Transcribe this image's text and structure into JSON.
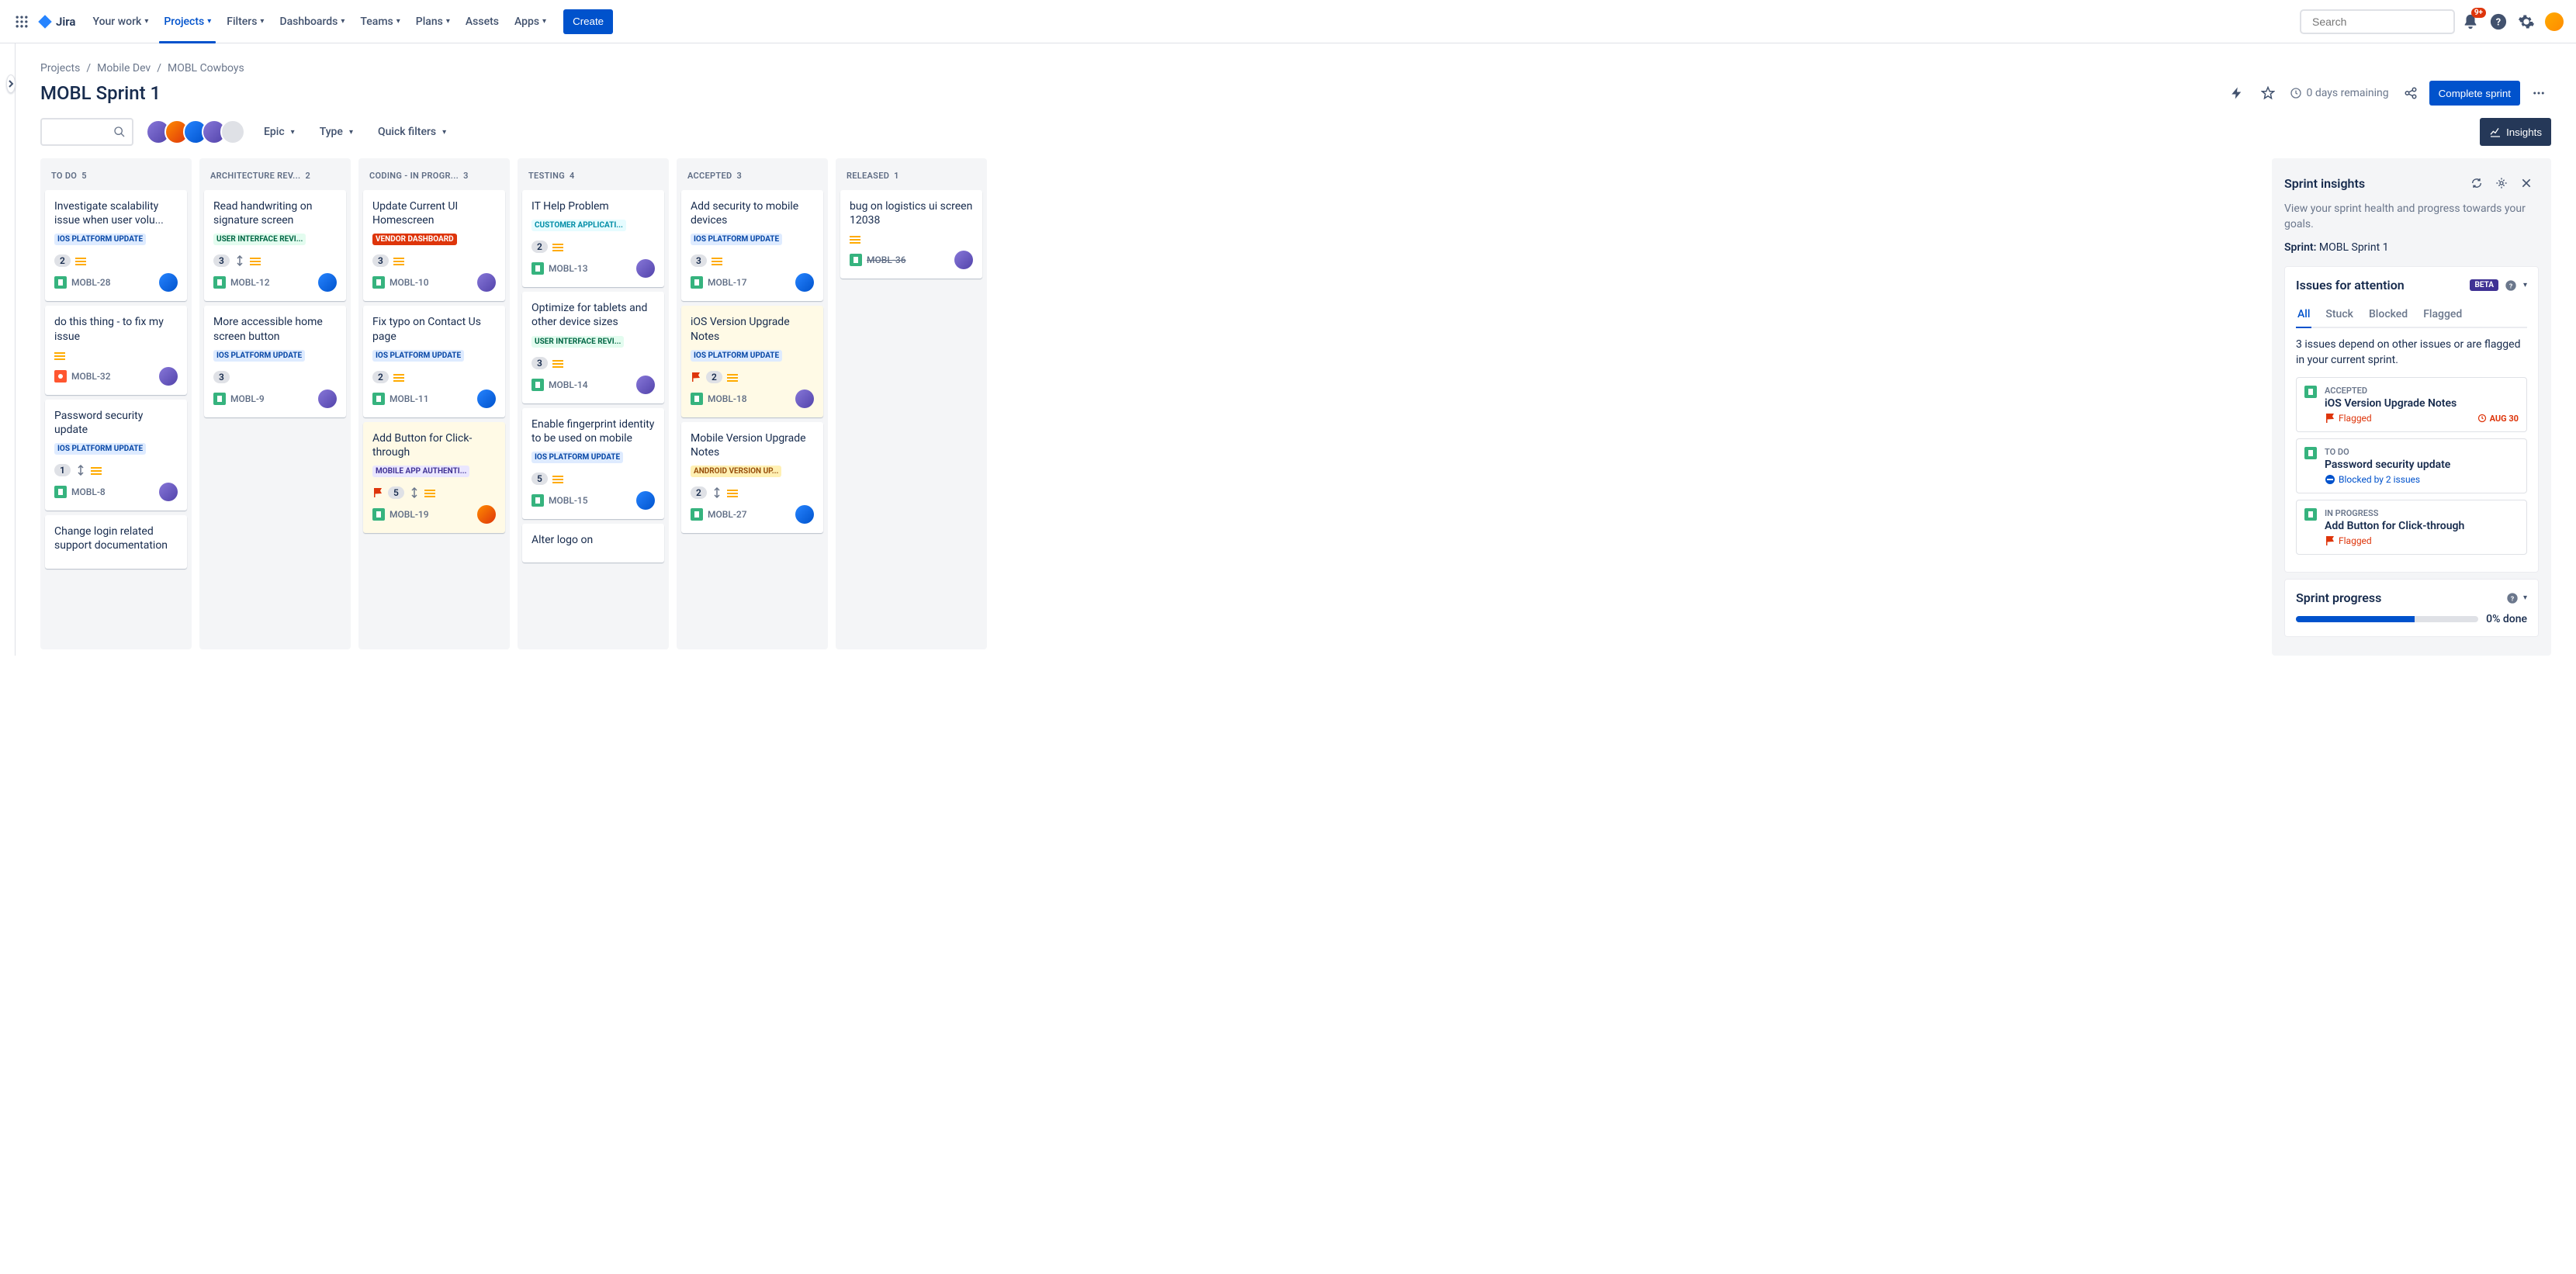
{
  "topnav": {
    "logo": "Jira",
    "items": [
      "Your work",
      "Projects",
      "Filters",
      "Dashboards",
      "Teams",
      "Plans",
      "Assets",
      "Apps"
    ],
    "active_index": 1,
    "has_chevron": [
      true,
      true,
      true,
      true,
      true,
      true,
      false,
      true
    ],
    "create": "Create",
    "search_placeholder": "Search",
    "notif_count": "9+"
  },
  "breadcrumb": [
    "Projects",
    "Mobile Dev",
    "MOBL Cowboys"
  ],
  "page": {
    "title": "MOBL Sprint 1",
    "days_remaining": "0 days remaining",
    "complete": "Complete sprint"
  },
  "filters": {
    "epic": "Epic",
    "type": "Type",
    "quick": "Quick filters",
    "insights_btn": "Insights"
  },
  "columns": [
    {
      "name": "TO DO",
      "count": "5"
    },
    {
      "name": "ARCHITECTURE REV...",
      "count": "2"
    },
    {
      "name": "CODING - IN PROGR...",
      "count": "3"
    },
    {
      "name": "TESTING",
      "count": "4"
    },
    {
      "name": "ACCEPTED",
      "count": "3"
    },
    {
      "name": "RELEASED",
      "count": "1"
    }
  ],
  "cards": {
    "c0": [
      {
        "title": "Investigate scalability issue when user volu...",
        "label": "IOS PLATFORM UPDATE",
        "label_class": "blue-light",
        "est": "2",
        "prio": "medium",
        "key": "MOBL-28",
        "type": "story",
        "avatar": "blue"
      },
      {
        "title": "do this thing - to fix my issue",
        "label": "",
        "est": "",
        "prio": "medium",
        "key": "MOBL-32",
        "type": "bug",
        "avatar": "purple"
      },
      {
        "title": "Password security update",
        "label": "IOS PLATFORM UPDATE",
        "label_class": "blue-light",
        "est": "1",
        "extra": "parent",
        "prio": "medium",
        "key": "MOBL-8",
        "type": "story",
        "avatar": "purple"
      },
      {
        "title": "Change login related support documentation",
        "label": "",
        "est": "",
        "key": "",
        "type": "",
        "partial": true
      }
    ],
    "c1": [
      {
        "title": "Read handwriting on signature screen",
        "label": "USER INTERFACE REVI...",
        "label_class": "green-light",
        "est": "3",
        "extra": "parent",
        "prio": "medium",
        "key": "MOBL-12",
        "type": "story",
        "avatar": "blue"
      },
      {
        "title": "More accessible home screen button",
        "label": "IOS PLATFORM UPDATE",
        "label_class": "blue-light",
        "est": "3",
        "prio": "",
        "key": "MOBL-9",
        "type": "story",
        "avatar": "purple"
      }
    ],
    "c2": [
      {
        "title": "Update Current UI Homescreen",
        "label": "VENDOR DASHBOARD",
        "label_class": "red",
        "est": "3",
        "prio": "medium",
        "key": "MOBL-10",
        "type": "story",
        "avatar": "purple"
      },
      {
        "title": "Fix typo on Contact Us page",
        "label": "IOS PLATFORM UPDATE",
        "label_class": "blue-light",
        "est": "2",
        "prio": "medium",
        "key": "MOBL-11",
        "type": "story",
        "avatar": "blue"
      },
      {
        "title": "Add Button for Click-through",
        "label": "MOBILE APP AUTHENTI...",
        "label_class": "purple",
        "est": "5",
        "flag": true,
        "extra": "parent",
        "prio": "medium",
        "key": "MOBL-19",
        "type": "story",
        "avatar": "orange",
        "flagged": true
      }
    ],
    "c3": [
      {
        "title": "IT Help Problem",
        "label": "CUSTOMER APPLICATI...",
        "label_class": "teal",
        "est": "2",
        "prio": "medium",
        "key": "MOBL-13",
        "type": "story",
        "avatar": "purple"
      },
      {
        "title": "Optimize for tablets and other device sizes",
        "label": "USER INTERFACE REVI...",
        "label_class": "green-light",
        "est": "3",
        "prio": "medium",
        "key": "MOBL-14",
        "type": "story",
        "avatar": "purple"
      },
      {
        "title": "Enable fingerprint identity to be used on mobile",
        "label": "IOS PLATFORM UPDATE",
        "label_class": "blue-light",
        "est": "5",
        "prio": "medium",
        "key": "MOBL-15",
        "type": "story",
        "avatar": "blue"
      },
      {
        "title": "Alter logo on",
        "partial": true
      }
    ],
    "c4": [
      {
        "title": "Add security to mobile devices",
        "label": "IOS PLATFORM UPDATE",
        "label_class": "blue-light",
        "est": "3",
        "prio": "medium",
        "key": "MOBL-17",
        "type": "story",
        "avatar": "blue"
      },
      {
        "title": "iOS Version Upgrade Notes",
        "label": "IOS PLATFORM UPDATE",
        "label_class": "blue-light",
        "est": "2",
        "flag": true,
        "prio": "medium",
        "key": "MOBL-18",
        "type": "story",
        "avatar": "purple",
        "flagged": true
      },
      {
        "title": "Mobile Version Upgrade Notes",
        "label": "ANDROID VERSION UP...",
        "label_class": "orange",
        "est": "2",
        "extra": "parent",
        "prio": "medium",
        "key": "MOBL-27",
        "type": "story",
        "avatar": "blue"
      }
    ],
    "c5": [
      {
        "title": "bug on logistics ui screen 12038",
        "label": "",
        "est": "",
        "prio": "medium",
        "key": "MOBL-36",
        "type": "story",
        "avatar": "purple",
        "done": true
      }
    ]
  },
  "insights": {
    "title": "Sprint insights",
    "desc": "View your sprint health and progress towards your goals.",
    "sprint_label": "Sprint:",
    "sprint_name": "MOBL Sprint 1",
    "attention_title": "Issues for attention",
    "beta": "BETA",
    "tabs": [
      "All",
      "Stuck",
      "Blocked",
      "Flagged"
    ],
    "attention_desc": "3 issues depend on other issues or are flagged in your current sprint.",
    "items": [
      {
        "status": "ACCEPTED",
        "title": "iOS Version Upgrade Notes",
        "tag": "Flagged",
        "tag_type": "flagged",
        "due": "AUG 30"
      },
      {
        "status": "TO DO",
        "title": "Password security update",
        "tag": "Blocked by 2 issues",
        "tag_type": "blocked"
      },
      {
        "status": "IN PROGRESS",
        "title": "Add Button for Click-through",
        "tag": "Flagged",
        "tag_type": "flagged"
      }
    ],
    "progress_title": "Sprint progress",
    "progress_pct": "0% done"
  }
}
